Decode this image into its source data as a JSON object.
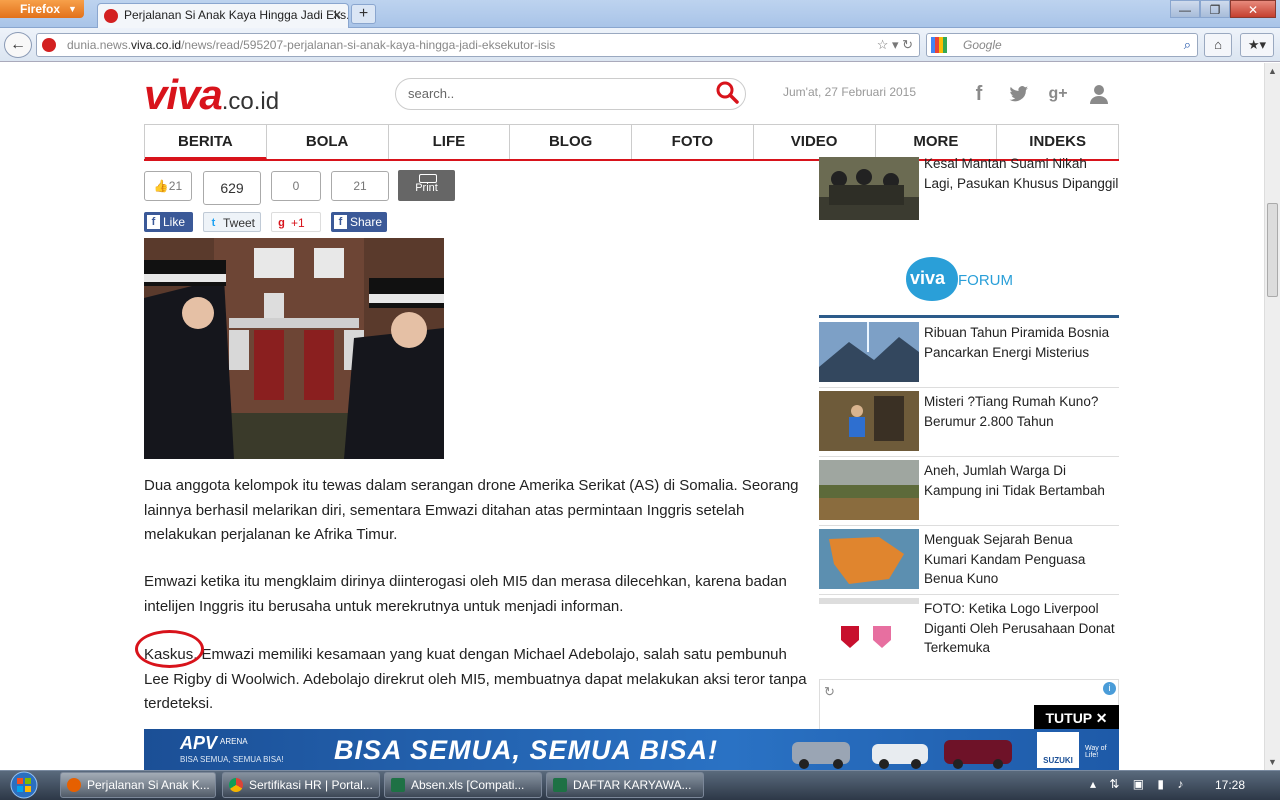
{
  "browser": {
    "app_button": "Firefox",
    "tab_title": "Perjalanan Si Anak Kaya Hingga Jadi Eks...",
    "url_prefix": "dunia.news.",
    "url_host": "viva.co.id",
    "url_path": "/news/read/595207-perjalanan-si-anak-kaya-hingga-jadi-eksekutor-isis",
    "search_engine_placeholder": "Google"
  },
  "site": {
    "logo_main": "viva",
    "logo_tld": ".co.id",
    "search_placeholder": "search..",
    "date": "Jum'at, 27 Februari 2015",
    "menu": [
      "BERITA",
      "BOLA",
      "LIFE",
      "BLOG",
      "FOTO",
      "VIDEO",
      "MORE",
      "INDEKS"
    ],
    "active_menu": "BERITA"
  },
  "share": {
    "like_count": "21",
    "tweet_count": "629",
    "gplus_count": "0",
    "fb_share_count": "21",
    "print_label": "Print",
    "like_label": "Like",
    "tweet_label": "Tweet",
    "gplus_label": "+1",
    "share_label": "Share"
  },
  "article": {
    "paragraph1": "Dua anggota kelompok itu tewas dalam serangan drone Amerika Serikat (AS) di Somalia. Seorang lainnya berhasil melarikan diri, sementara Emwazi ditahan atas permintaan Inggris setelah melakukan perjalanan ke Afrika Timur.",
    "paragraph2": "Emwazi ketika itu mengklaim dirinya diinterogasi oleh MI5 dan merasa dilecehkan, karena badan intelijen Inggris itu berusaha untuk merekrutnya untuk menjadi informan.",
    "paragraph3": "Kaskus. Emwazi memiliki kesamaan yang kuat dengan Michael Adebolajo, salah satu pembunuh Lee Rigby di Woolwich. Adebolajo direkrut oleh MI5, membuatnya dapat melakukan aksi teror tanpa terdeteksi."
  },
  "sidebar": {
    "top_item": "Kesal Mantan Suami Nikah Lagi, Pasukan Khusus Dipanggil",
    "forum_logo_a": "viva",
    "forum_logo_b": "FORUM",
    "items": [
      "Ribuan Tahun Piramida Bosnia Pancarkan Energi Misterius",
      "Misteri ?Tiang Rumah Kuno? Berumur 2.800 Tahun",
      "Aneh, Jumlah Warga Di Kampung ini Tidak Bertambah",
      "Menguak Sejarah Benua Kumari Kandam Penguasa Benua Kuno",
      "FOTO: Ketika Logo Liverpool Diganti Oleh Perusahaan Donat Terkemuka"
    ],
    "close_ad": "TUTUP ✕"
  },
  "banner": {
    "brand": "APV",
    "brand_sub": "ARENA",
    "tagline_small": "BISA SEMUA, SEMUA BISA!",
    "headline": "BISA SEMUA, SEMUA BISA!",
    "maker": "SUZUKI",
    "maker_tag": "Way of Life!"
  },
  "taskbar": {
    "items": [
      "Perjalanan Si Anak K...",
      "Sertifikasi HR | Portal...",
      "Absen.xls  [Compati...",
      "DAFTAR KARYAWA..."
    ],
    "clock": "17:28"
  }
}
